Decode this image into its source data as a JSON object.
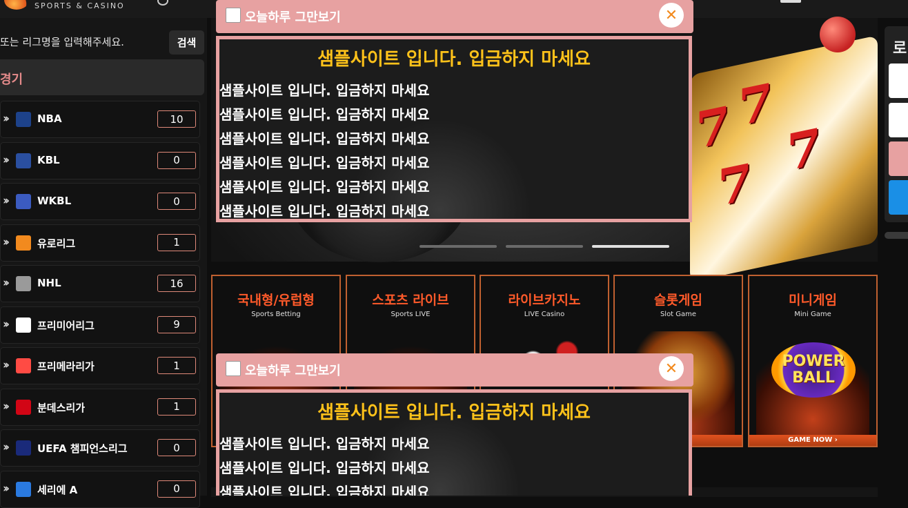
{
  "header": {
    "logo_text": "SPORTS & CASINO"
  },
  "sidebar": {
    "search_placeholder": "또는 리그명을 입력해주세요.",
    "search_button": "검색",
    "section_title": "경기",
    "leagues": [
      {
        "name": "NBA",
        "count": "10",
        "logo": "nba-icon"
      },
      {
        "name": "KBL",
        "count": "0",
        "logo": "kbl-icon"
      },
      {
        "name": "WKBL",
        "count": "0",
        "logo": "wkbl-icon"
      },
      {
        "name": "유로리그",
        "count": "1",
        "logo": "euroleague-icon"
      },
      {
        "name": "NHL",
        "count": "16",
        "logo": "nhl-icon"
      },
      {
        "name": "프리미어리그",
        "count": "9",
        "logo": "premier-league-icon"
      },
      {
        "name": "프리메라리가",
        "count": "1",
        "logo": "laliga-icon"
      },
      {
        "name": "분데스리가",
        "count": "1",
        "logo": "bundesliga-icon"
      },
      {
        "name": "UEFA 챔피언스리그",
        "count": "0",
        "logo": "uefa-icon"
      },
      {
        "name": "세리에 A",
        "count": "0",
        "logo": "serie-a-icon"
      }
    ]
  },
  "cards": [
    {
      "title": "국내형/유럽형",
      "subtitle": "Sports Betting",
      "button": ""
    },
    {
      "title": "스포츠 라이브",
      "subtitle": "Sports LIVE",
      "button": ""
    },
    {
      "title": "라이브카지노",
      "subtitle": "LIVE Casino",
      "button": ""
    },
    {
      "title": "슬롯게임",
      "subtitle": "Slot Game",
      "button": "W ›"
    },
    {
      "title": "미니게임",
      "subtitle": "Mini Game",
      "button": "GAME NOW ›",
      "art_text": [
        "POWER",
        "BALL"
      ]
    }
  ],
  "right_panel": {
    "title_char": "로"
  },
  "popups": [
    {
      "dismiss_label": "오늘하루 그만보기",
      "close": "✕",
      "title": "샘플사이트 입니다. 입금하지 마세요",
      "lines": [
        "샘플사이트 입니다. 입금하지 마세요",
        "샘플사이트 입니다. 입금하지 마세요",
        "샘플사이트 입니다. 입금하지 마세요",
        "샘플사이트 입니다. 입금하지 마세요",
        "샘플사이트 입니다. 입금하지 마세요",
        "샘플사이트 입니다. 입금하지 마세요"
      ]
    },
    {
      "dismiss_label": "오늘하루 그만보기",
      "close": "✕",
      "title": "샘플사이트 입니다. 입금하지 마세요",
      "lines": [
        "샘플사이트 입니다. 입금하지 마세요",
        "샘플사이트 입니다. 입금하지 마세요",
        "샘플사이트 입니다. 입금하지 마세요"
      ]
    }
  ],
  "colors": {
    "accent": "#ff5a2a",
    "popup_pink": "#e7a1a1",
    "popup_title": "#ffc21a",
    "count_border": "#e08a7a"
  }
}
